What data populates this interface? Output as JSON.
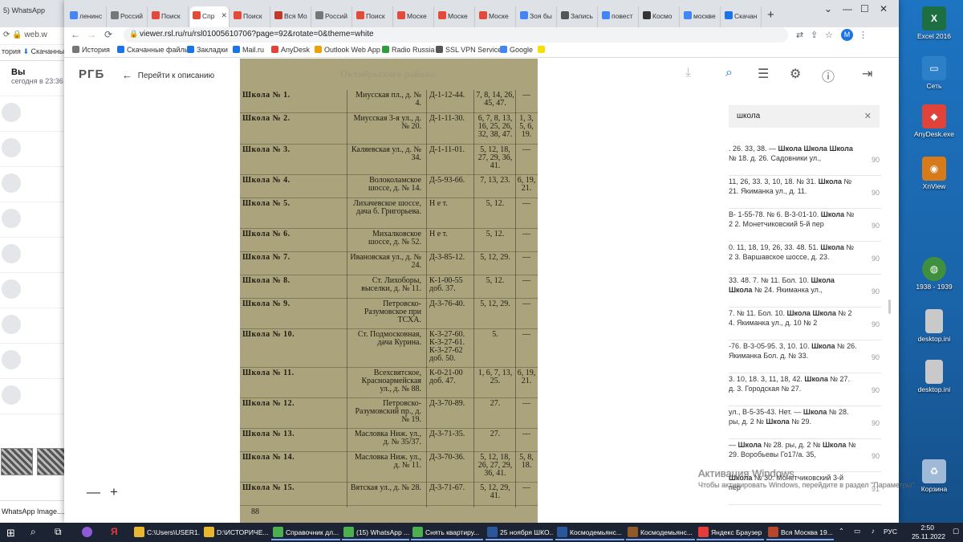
{
  "desktop": {
    "icons": [
      {
        "label": "Excel 2016",
        "glyph": "X",
        "color": "#1d6f42"
      },
      {
        "label": "Сеть",
        "glyph": "🖥",
        "color": "#2b80c8"
      },
      {
        "label": "AnyDesk.exe",
        "glyph": "◆",
        "color": "#e0433a"
      },
      {
        "label": "XnView",
        "glyph": "◉",
        "color": "#d67a1a"
      },
      {
        "label": "1938 - 1939",
        "glyph": "🌐",
        "color": "#3e8f3e"
      },
      {
        "label": "desktop.ini",
        "glyph": "",
        "color": "#c9c9c9"
      },
      {
        "label": "desktop.ini",
        "glyph": "",
        "color": "#c9c9c9"
      },
      {
        "label": "Корзина",
        "glyph": "♻",
        "color": "#9fb9d6"
      }
    ]
  },
  "whatsapp": {
    "tab": "5) WhatsApp",
    "url": "web.w",
    "bookmark_history": "тория",
    "bookmark_downloads": "Скачанны",
    "chat_name": "Вы",
    "chat_time": "сегодня в 23:36",
    "footer": "WhatsApp Image....jpe"
  },
  "browser": {
    "tabs": [
      {
        "label": "ленинс",
        "fav": "G",
        "color": "#4285f4"
      },
      {
        "label": "Россий",
        "fav": "▤",
        "color": "#777"
      },
      {
        "label": "Поиск",
        "fav": "▣",
        "color": "#e34a3a"
      },
      {
        "label": "Спр",
        "fav": "▣",
        "color": "#e34a3a"
      },
      {
        "label": "Поиск",
        "fav": "▣",
        "color": "#e34a3a"
      },
      {
        "label": "Вся Мо",
        "fav": "▣",
        "color": "#c0392b"
      },
      {
        "label": "Россий",
        "fav": "▤",
        "color": "#777"
      },
      {
        "label": "Поиск",
        "fav": "▣",
        "color": "#e34a3a"
      },
      {
        "label": "Моске",
        "fav": "▣",
        "color": "#e34a3a"
      },
      {
        "label": "Моске",
        "fav": "▣",
        "color": "#e34a3a"
      },
      {
        "label": "Моске",
        "fav": "▣",
        "color": "#e34a3a"
      },
      {
        "label": "Зоя бы",
        "fav": "G",
        "color": "#4285f4"
      },
      {
        "label": "Запись",
        "fav": "◍",
        "color": "#555"
      },
      {
        "label": "повест",
        "fav": "G",
        "color": "#4285f4"
      },
      {
        "label": "Космо",
        "fav": "▤",
        "color": "#333"
      },
      {
        "label": "москве",
        "fav": "G",
        "color": "#4285f4"
      },
      {
        "label": "Скачан",
        "fav": "⬇",
        "color": "#1a73e8"
      }
    ],
    "active_tab_index": 3,
    "url": "viewer.rsl.ru/ru/rsl01005610706?page=92&rotate=0&theme=white",
    "avatar_letter": "M",
    "bookmarks": [
      {
        "label": "История",
        "color": "#777"
      },
      {
        "label": "Скачанные файлы",
        "color": "#1a73e8"
      },
      {
        "label": "Закладки",
        "color": "#1a73e8"
      },
      {
        "label": "Mail.ru",
        "color": "#1a73e8"
      },
      {
        "label": "AnyDesk",
        "color": "#e0433a"
      },
      {
        "label": "Outlook Web App",
        "color": "#f0a000"
      },
      {
        "label": "Radio Russia",
        "color": "#2e9d3a"
      },
      {
        "label": "SSL VPN Service",
        "color": "#555"
      },
      {
        "label": "Google",
        "color": "#4285f4"
      },
      {
        "label": "",
        "color": "#f5e000"
      }
    ]
  },
  "rgb": {
    "logo": "РГБ",
    "back_label": "Перейти к описанию"
  },
  "scan": {
    "heading": "Октябрьского района.",
    "page_number": "88",
    "rows": [
      {
        "name": "Школа № 1.",
        "addr": "Миусская пл., д. № 4.",
        "phone": "Д-1-12-44.",
        "routes": "7, 8, 14, 26, 45, 47.",
        "extra": "—",
        "h": 29
      },
      {
        "name": "Школа № 2.",
        "addr": "Миусская 3-я ул., д. № 20.",
        "phone": "Д-1-11-30.",
        "routes": "6, 7, 8, 13, 16, 25, 26, 32, 38, 47.",
        "extra": "1, 3, 5, 6, 19.",
        "h": 39
      },
      {
        "name": "Школа № 3.",
        "addr": "Каляевская ул., д. № 34.",
        "phone": "Д-1-11-01.",
        "routes": "5, 12, 18, 27, 29, 36, 41.",
        "extra": "—",
        "h": 38
      },
      {
        "name": "Школа № 4.",
        "addr": "Волоколамское шоссе, д. № 14.",
        "phone": "Д-5-93-66.",
        "routes": "7, 13, 23.",
        "extra": "6, 19, 21.",
        "h": 29
      },
      {
        "name": "Школа № 5.",
        "addr": "Лихачевское шоссе, дача б. Григорьева.",
        "phone": "Н е т.",
        "routes": "5, 12.",
        "extra": "—",
        "h": 38
      },
      {
        "name": "Школа № 6.",
        "addr": "Михалковское шоссе, д. № 52.",
        "phone": "Н е т.",
        "routes": "5, 12.",
        "extra": "—",
        "h": 29
      },
      {
        "name": "Школа № 7.",
        "addr": "Ивановская ул., д. № 24.",
        "phone": "Д-3-85-12.",
        "routes": "5, 12, 29.",
        "extra": "—",
        "h": 29
      },
      {
        "name": "Школа № 8.",
        "addr": "Ст. Лихоборы, выселки, д. № 11.",
        "phone": "К-1-00-55 доб. 37.",
        "routes": "5, 12.",
        "extra": "—",
        "h": 29
      },
      {
        "name": "Школа № 9.",
        "addr": "Петровско-Разумовское при ТСХА.",
        "phone": "Д-3-76-40.",
        "routes": "5, 12, 29.",
        "extra": "—",
        "h": 38
      },
      {
        "name": "Школа № 10.",
        "addr": "Ст. Подмосковная, дача Курина.",
        "phone": "К-3-27-60. К-3-27-61. К-3-27-62 доб. 50.",
        "routes": "5.",
        "extra": "—",
        "h": 48
      },
      {
        "name": "Школа № 11.",
        "addr": "Всехсвятское, Красноармейская ул., д. № 88.",
        "phone": "К-0-21-00 доб. 47.",
        "routes": "1, 6, 7, 13, 25.",
        "extra": "6, 19, 21.",
        "h": 38
      },
      {
        "name": "Школа № 12.",
        "addr": "Петровско-Разумовский пр., д. № 19.",
        "phone": "Д-3-70-89.",
        "routes": "27.",
        "extra": "—",
        "h": 38
      },
      {
        "name": "Школа № 13.",
        "addr": "Масловка Ниж. ул., д. № 35/37.",
        "phone": "Д-3-71-35.",
        "routes": "27.",
        "extra": "—",
        "h": 29
      },
      {
        "name": "Школа № 14.",
        "addr": "Масловка Ниж. ул., д. № 11.",
        "phone": "Д-3-70-36.",
        "routes": "5, 12, 18, 26, 27, 29, 36, 41.",
        "extra": "5, 8, 18.",
        "h": 38
      },
      {
        "name": "Школа № 15.",
        "addr": "Вятская ул., д. № 28.",
        "phone": "Д-3-71-67.",
        "routes": "5, 12, 29, 41.",
        "extra": "—",
        "h": 29
      }
    ]
  },
  "panel": {
    "search_value": "школа",
    "results": [
      {
        "text": ". 26. 33, 38. — Школа Школа Школа № 18. д. 26. Садовники ул.,",
        "page": "90"
      },
      {
        "text": "11, 26, 33. 3, 10, 18. № 31. Школа № 21. Якиманка ул., д. 11.",
        "page": "90"
      },
      {
        "text": "В- 1-55-78. № 6. В-3-01-10. Школа № 2 2. Монетчиковский 5-й пер",
        "page": "90"
      },
      {
        "text": "0. 11, 18, 19, 26, 33. 48. 51. Школа № 2 3. Варшавское шоссе, д. 23.",
        "page": "90"
      },
      {
        "text": "33. 48. 7. № 11. Бол. 10. Школа Школа № 24. Якиманка ул.,",
        "page": "90"
      },
      {
        "text": "7. № 11. Бол. 10. Школа Школа № 2 4. Якиманка ул., д. 10 № 2",
        "page": "90"
      },
      {
        "text": "-76. В-3-05-95. 3, 10. 10. Школа № 26. Якиманка Бол. д. № 33.",
        "page": "90"
      },
      {
        "text": "3. 10, 18. 3, 11, 18, 42. Школа № 27. д. 3. Городская № 27.",
        "page": "90"
      },
      {
        "text": "ул., В-5-35-43. Нет. — Школа № 28. ры, д. 2 № Школа № 29.",
        "page": "90"
      },
      {
        "text": "— Школа № 28. ры, д. 2 № Школа № 29. Воробьевы Го17/а. 35,",
        "page": "90"
      },
      {
        "text": "Школа № 30. Монетчиковский 3-й пер",
        "page": "91"
      }
    ]
  },
  "activation": {
    "title": "Активация Windows",
    "subtitle": "Чтобы активировать Windows, перейдите в раздел \"Параметры\"."
  },
  "taskbar": {
    "items": [
      {
        "label": "C:\\Users\\USER1...",
        "color": "#e8b730",
        "run": false
      },
      {
        "label": "D:\\ИСТОРИЧЕ...",
        "color": "#e8b730",
        "run": false
      },
      {
        "label": "Справочник дл...",
        "color": "#4caf50",
        "run": true
      },
      {
        "label": "(15) WhatsApp ...",
        "color": "#4caf50",
        "run": true
      },
      {
        "label": "Снять квартиру...",
        "color": "#4caf50",
        "run": true
      },
      {
        "label": "25 ноября ШКО...",
        "color": "#2b579a",
        "run": true
      },
      {
        "label": "Космодемьянс...",
        "color": "#2b579a",
        "run": true
      },
      {
        "label": "Космодемьянс...",
        "color": "#8e5a2b",
        "run": true
      },
      {
        "label": "Яндекс Браузер",
        "color": "#e43b3b",
        "run": true
      },
      {
        "label": "Вся Москва 19...",
        "color": "#b7472a",
        "run": true
      }
    ],
    "lang": "РУС",
    "time": "2:50",
    "date": "25.11.2022"
  }
}
